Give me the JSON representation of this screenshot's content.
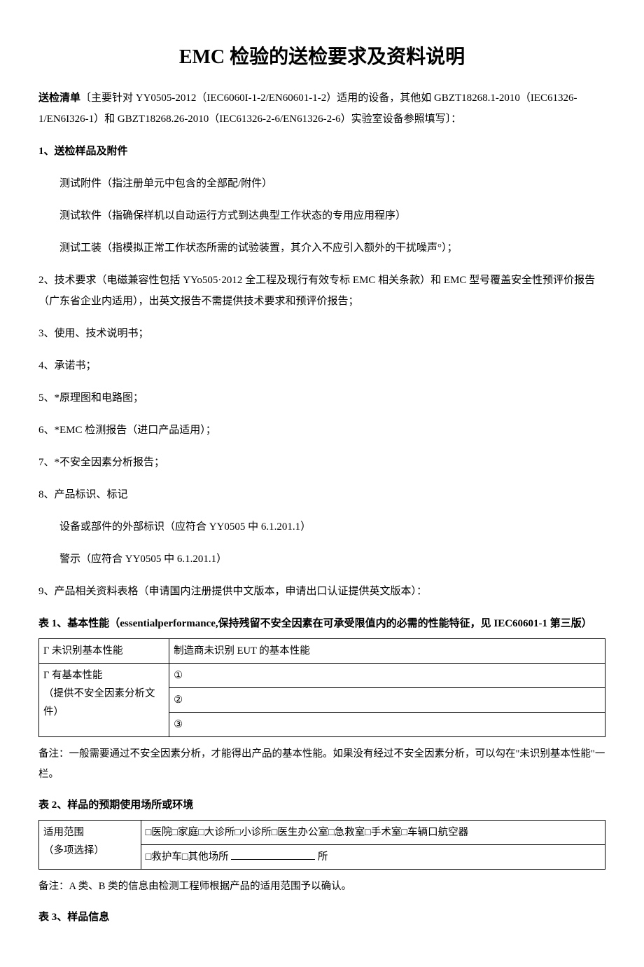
{
  "title": "EMC 检验的送检要求及资料说明",
  "intro": "送检清单〔主要针对 YY0505-2012（IEC6060I-1-2/EN60601-1-2）适用的设备，其他如 GBZT18268.1-2010（IEC61326-1/EN6I326-1）和 GBZT18268.26-2010（IEC61326-2-6/EN61326-2-6）实验室设备参照填写〕：",
  "items": {
    "n1": "1、送检样品及附件",
    "n1a": "测试附件（指注册单元中包含的全部配/附件）",
    "n1b": "测试软件（指确保样机以自动运行方式到达典型工作状态的专用应用程序）",
    "n1c": "测试工装（指模拟正常工作状态所需的试验装置，其介入不应引入额外的干扰噪声°）；",
    "n2": "2、技术要求（电磁兼容性包括 YYo505·2012 全工程及现行有效专标 EMC 相关条款）和 EMC 型号覆盖安全性预评价报告（广东省企业内适用），出英文报告不需提供技术要求和预评价报告；",
    "n3": "3、使用、技术说明书；",
    "n4": "4、承诺书；",
    "n5": "5、*原理图和电路图；",
    "n6": "6、*EMC 检测报告（进口产品适用）；",
    "n7": "7、*不安全因素分析报告；",
    "n8": "8、产品标识、标记",
    "n8a": "设备或部件的外部标识（应符合 YY0505 中 6.1.201.1）",
    "n8b": "警示（应符合 YY0505 中 6.1.201.1）",
    "n9": "9、产品相关资料表格（申请国内注册提供中文版本，申请出口认证提供英文版本）："
  },
  "table1": {
    "heading": "表 1、基本性能（essentialperformance,保持残留不安全因素在可承受限值内的必需的性能特征，见 IEC60601-1 第三版）",
    "r1c1": "Γ 未识别基本性能",
    "r1c2": "制造商未识别 EUT 的基本性能",
    "r2c1": "Γ 有基本性能\n（提供不安全因素分析文件）",
    "r2a": "①",
    "r2b": "②",
    "r2c": "③",
    "note": "备注：一般需要通过不安全因素分析，才能得出产品的基本性能。如果没有经过不安全因素分析，可以勾在\"未识别基本性能\"一栏。"
  },
  "table2": {
    "heading": "表 2、样品的预期使用场所或环境",
    "r1c1": "适用范围\n（多项选择）",
    "r1c2a": "□医院□家庭□大诊所□小诊所□医生办公室□急救室□手术室□车辆口航空器",
    "r1c2b_prefix": "□救护车□其他场所 ",
    "r1c2b_suffix": " 所",
    "note": "备注：A 类、B 类的信息由检测工程师根据产品的适用范围予以确认。"
  },
  "table3": {
    "heading": "表 3、样品信息"
  }
}
